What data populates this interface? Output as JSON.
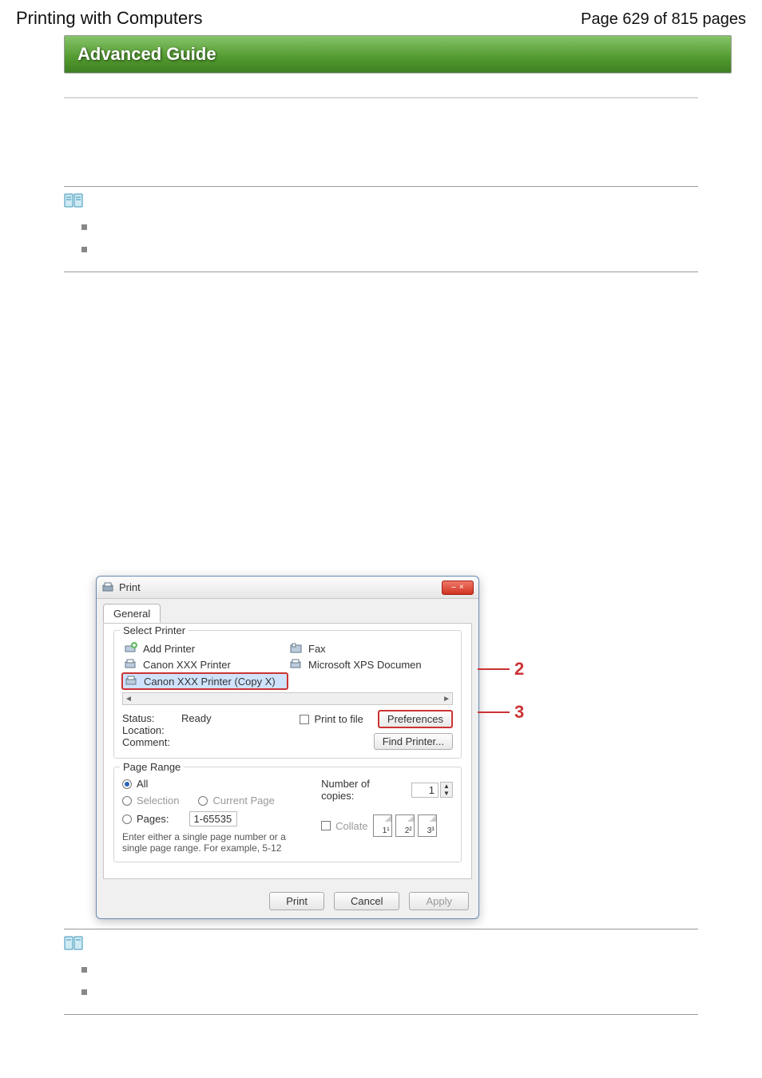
{
  "header": {
    "title": "Printing with Computers",
    "page_indicator": "Page 629 of 815 pages"
  },
  "banner": {
    "label": "Advanced Guide"
  },
  "note1": {
    "bullets": [
      "",
      ""
    ]
  },
  "dialog": {
    "title": "Print",
    "tab_label": "General",
    "select_printer_label": "Select Printer",
    "printers": [
      {
        "name": "Add Printer",
        "kind": "add"
      },
      {
        "name": "Canon XXX Printer",
        "kind": "printer"
      },
      {
        "name": "Canon XXX Printer (Copy X)",
        "kind": "printer",
        "selected": true
      },
      {
        "name": "Fax",
        "kind": "fax"
      },
      {
        "name": "Microsoft XPS Documen",
        "kind": "printer"
      }
    ],
    "status_label": "Status:",
    "status_value": "Ready",
    "location_label": "Location:",
    "comment_label": "Comment:",
    "print_to_file_label": "Print to file",
    "preferences_label": "Preferences",
    "find_printer_label": "Find Printer...",
    "page_range": {
      "legend": "Page Range",
      "all_label": "All",
      "selection_label": "Selection",
      "current_page_label": "Current Page",
      "pages_label": "Pages:",
      "pages_value": "1-65535",
      "hint": "Enter either a single page number or a single page range.  For example, 5-12"
    },
    "copies": {
      "label": "Number of copies:",
      "value": "1",
      "collate_label": "Collate",
      "thumbs": [
        "1¹",
        "2²",
        "3³"
      ]
    },
    "buttons": {
      "print": "Print",
      "cancel": "Cancel",
      "apply": "Apply"
    }
  },
  "callouts": {
    "c2": "2",
    "c3": "3"
  },
  "note2": {
    "bullets": [
      "",
      ""
    ]
  }
}
